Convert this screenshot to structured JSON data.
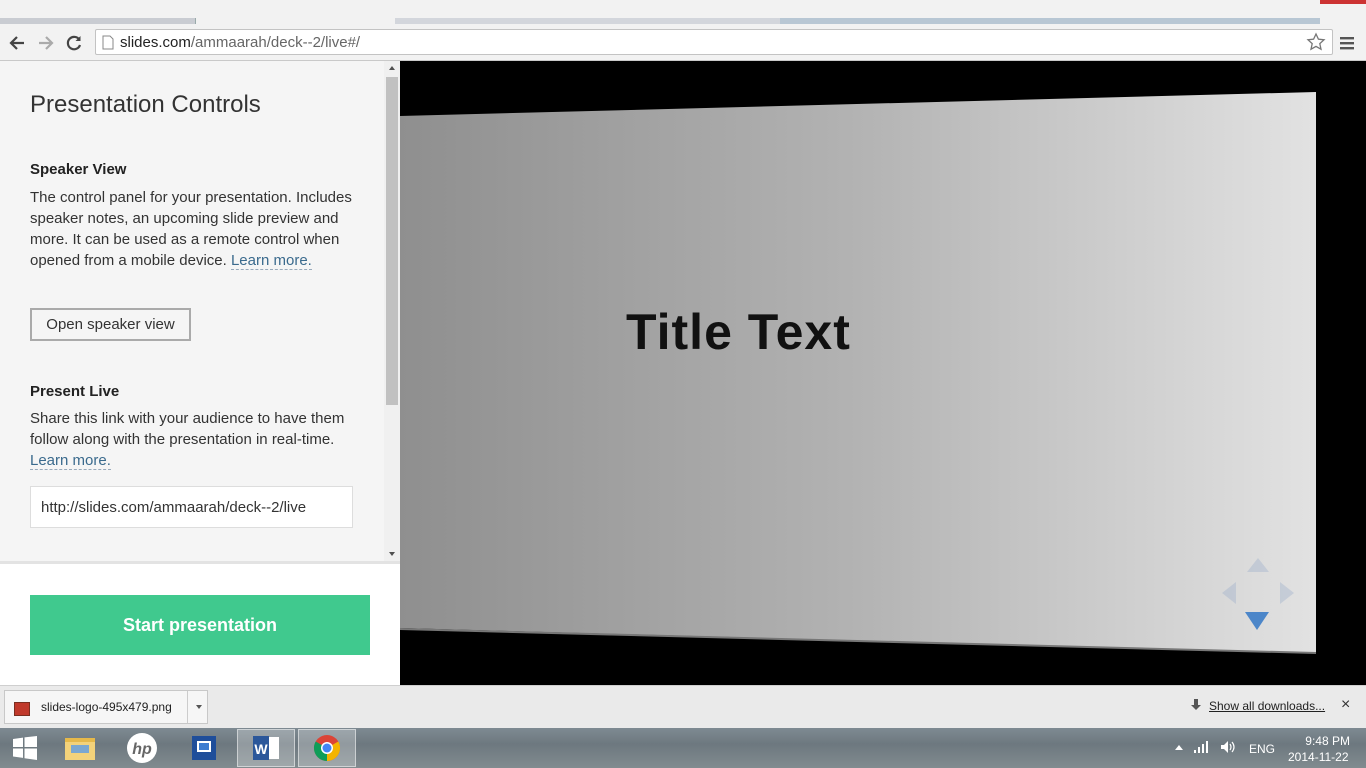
{
  "browser": {
    "url_host": "slides.com",
    "url_path": "/ammaarah/deck--2/live#/"
  },
  "panel": {
    "title": "Presentation Controls",
    "speaker_view": {
      "heading": "Speaker View",
      "description": "The control panel for your presentation. Includes speaker notes, an upcoming slide preview and more. It can be used as a remote control when opened from a mobile device. ",
      "learn_more": "Learn more.",
      "button": "Open speaker view"
    },
    "present_live": {
      "heading": "Present Live",
      "description": "Share this link with your audience to have them follow along with the presentation in real-time. ",
      "learn_more": "Learn more.",
      "link_value": "http://slides.com/ammaarah/deck--2/live"
    },
    "start_button": "Start presentation"
  },
  "slide": {
    "title": "Title Text"
  },
  "downloads": {
    "file_name": "slides-logo-495x479.png",
    "show_all": "Show all downloads...",
    "close": "×"
  },
  "taskbar": {
    "apps": [
      "windows-start",
      "file-explorer",
      "hp",
      "remote-desktop",
      "word",
      "chrome"
    ],
    "lang": "ENG",
    "time": "9:48 PM",
    "date": "2014-11-22"
  },
  "colors": {
    "start_button": "#40c98e",
    "link": "#3a6a8d",
    "nav_down": "#4c86c9"
  }
}
